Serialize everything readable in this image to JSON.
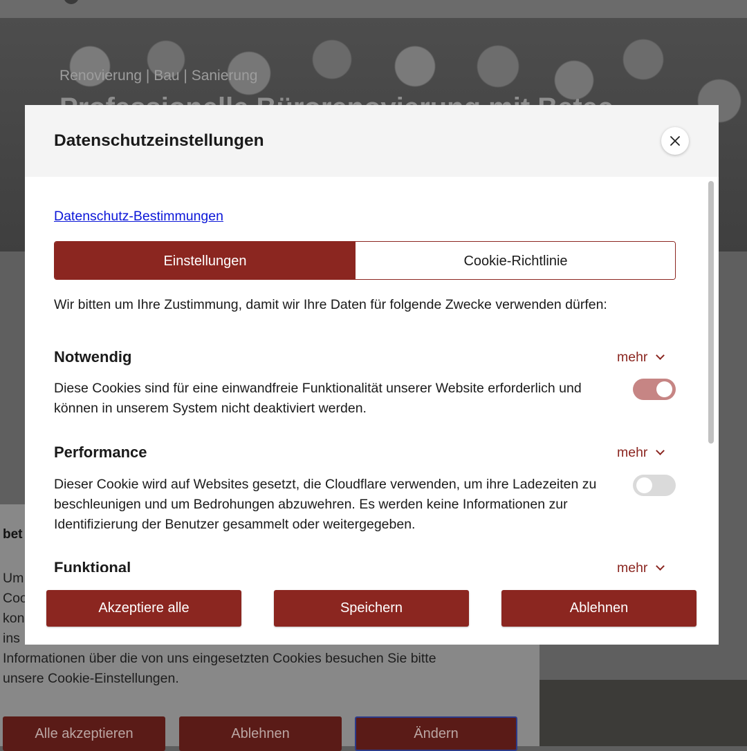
{
  "background": {
    "hero_subtitle": "Renovierung | Bau | Sanierung",
    "hero_title": "Professionelle Bürorenovierung mit Betec",
    "banner": {
      "title": "bet",
      "text": "Um Cookies ... kon... ins... Informationen über die von uns eingesetzten Cookies besuchen Sie bitte unsere Cookie-Einstellungen.",
      "text_lines": [
        "Um",
        "Coo",
        "kon",
        "ins",
        "Informationen über die von uns eingesetzten Cookies besuchen Sie bitte",
        "unsere Cookie-Einstellungen."
      ],
      "buttons": [
        "Alle akzeptieren",
        "Ablehnen",
        "Ändern"
      ]
    }
  },
  "modal": {
    "title": "Datenschutzeinstellungen",
    "close_icon": "close-icon",
    "privacy_link": "Datenschutz-Bestimmungen",
    "tabs": [
      {
        "label": "Einstellungen",
        "active": true
      },
      {
        "label": "Cookie-Richtlinie",
        "active": false
      }
    ],
    "intro": "Wir bitten um Ihre Zustimmung, damit wir Ihre Daten für folgende Zwecke verwenden dürfen:",
    "more_label": "mehr",
    "sections": [
      {
        "title": "Notwendig",
        "description": "Diese Cookies sind für eine einwandfreie Funktionalität unserer Website erforderlich und können in unserem System nicht deaktiviert werden.",
        "enabled": true
      },
      {
        "title": "Performance",
        "description": "Dieser Cookie wird auf Websites gesetzt, die Cloudflare verwenden, um ihre Ladezeiten zu beschleunigen und um Bedrohungen abzuwehren. Es werden keine Informationen zur Identifizierung der Benutzer gesammelt oder weitergegeben.",
        "enabled": false
      },
      {
        "title": "Funktional",
        "description": "",
        "enabled": false
      }
    ],
    "footer_buttons": {
      "accept_all": "Akzeptiere alle",
      "save": "Speichern",
      "reject": "Ablehnen"
    }
  },
  "colors": {
    "accent": "#8b2620",
    "toggle_on": "#c68584",
    "toggle_off": "#dadada",
    "link": "#0b16d8"
  }
}
